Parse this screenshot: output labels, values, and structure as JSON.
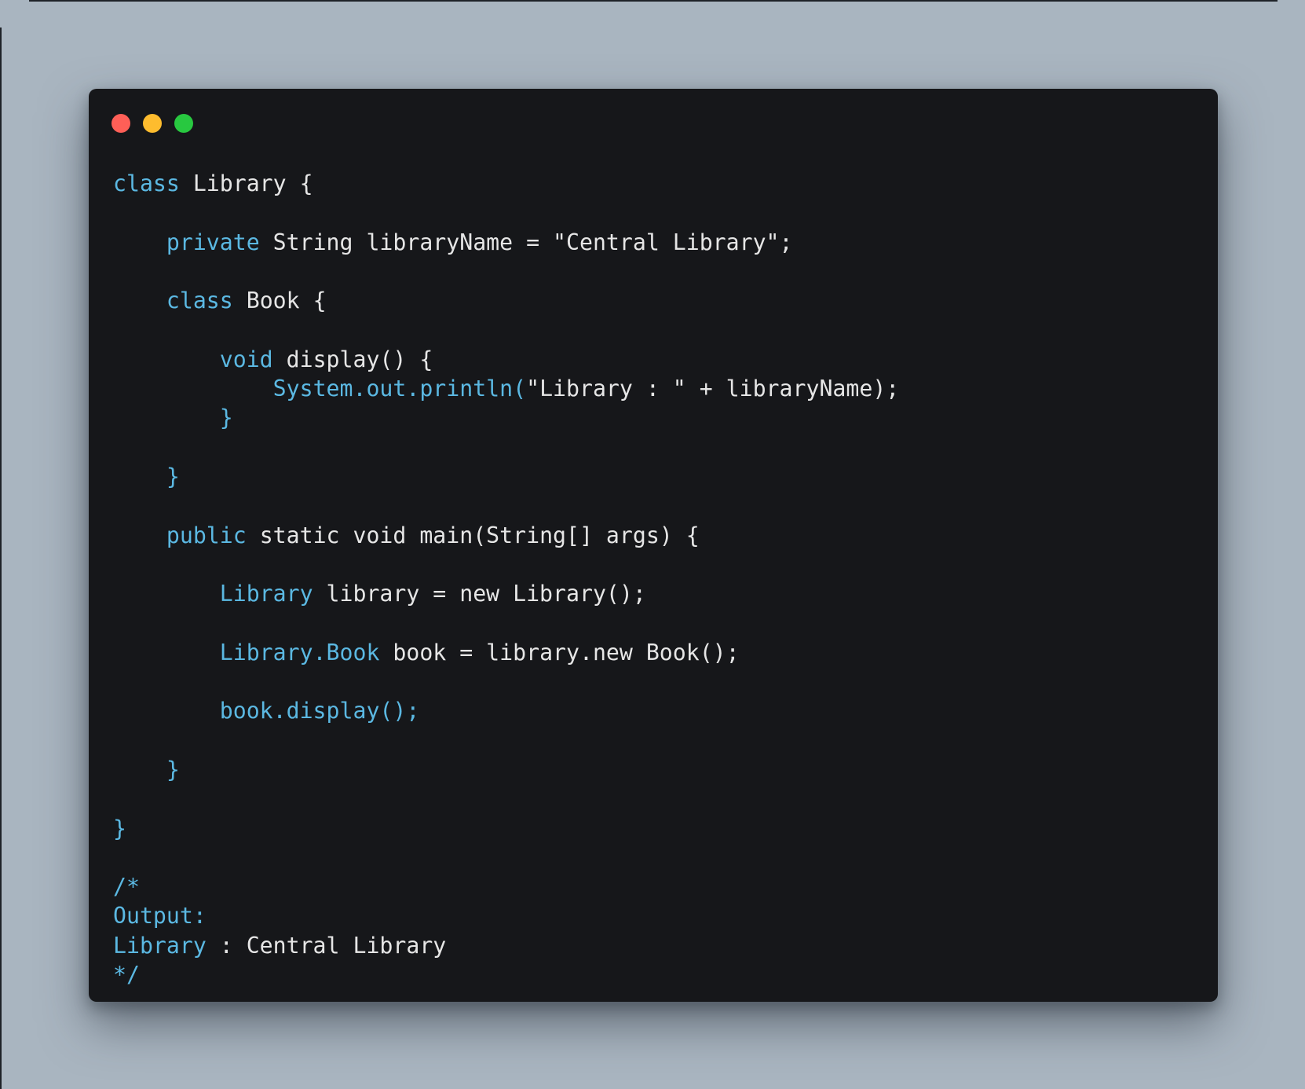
{
  "theme": {
    "page_bg": "#a9b5c0",
    "window_bg": "#16171a",
    "keyword_color": "#5bb8e2",
    "text_color": "#e6e6e6"
  },
  "window_controls": [
    {
      "name": "close-dot-icon",
      "color": "#ff5f57"
    },
    {
      "name": "minimize-dot-icon",
      "color": "#febc2e"
    },
    {
      "name": "maximize-dot-icon",
      "color": "#28c840"
    }
  ],
  "code_lines": [
    [
      {
        "k": "class"
      },
      {
        "t": " Library {"
      }
    ],
    [],
    [
      {
        "t": "    "
      },
      {
        "k": "private"
      },
      {
        "t": " String libraryName = \"Central Library\";"
      }
    ],
    [],
    [
      {
        "t": "    "
      },
      {
        "k": "class"
      },
      {
        "t": " Book {"
      }
    ],
    [],
    [
      {
        "t": "        "
      },
      {
        "k": "void"
      },
      {
        "t": " display() {"
      }
    ],
    [
      {
        "t": "            "
      },
      {
        "k": "System.out.println("
      },
      {
        "t": "\"Library : \" + libraryName);"
      }
    ],
    [
      {
        "t": "        "
      },
      {
        "k": "}"
      }
    ],
    [],
    [
      {
        "t": "    "
      },
      {
        "k": "}"
      }
    ],
    [],
    [
      {
        "t": "    "
      },
      {
        "k": "public"
      },
      {
        "t": " static void main(String[] args) {"
      }
    ],
    [],
    [
      {
        "t": "        "
      },
      {
        "k": "Library"
      },
      {
        "t": " library = new Library();"
      }
    ],
    [],
    [
      {
        "t": "        "
      },
      {
        "k": "Library.Book"
      },
      {
        "t": " book = library.new Book();"
      }
    ],
    [],
    [
      {
        "t": "        "
      },
      {
        "k": "book.display();"
      }
    ],
    [],
    [
      {
        "t": "    "
      },
      {
        "k": "}"
      }
    ],
    [],
    [
      {
        "k": "}"
      }
    ],
    [],
    [
      {
        "k": "/*"
      }
    ],
    [
      {
        "k": "Output:"
      }
    ],
    [
      {
        "k": "Library"
      },
      {
        "t": " : Central Library"
      }
    ],
    [
      {
        "k": "*/"
      }
    ]
  ]
}
